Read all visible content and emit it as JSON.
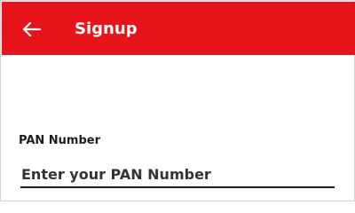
{
  "app_bar": {
    "title": "Signup",
    "back_icon": "arrow-left-icon",
    "background_color": "#e8141c",
    "text_color": "#ffffff"
  },
  "form": {
    "pan_label": "PAN Number",
    "pan_input": {
      "value": "",
      "placeholder": "Enter your PAN Number"
    }
  }
}
